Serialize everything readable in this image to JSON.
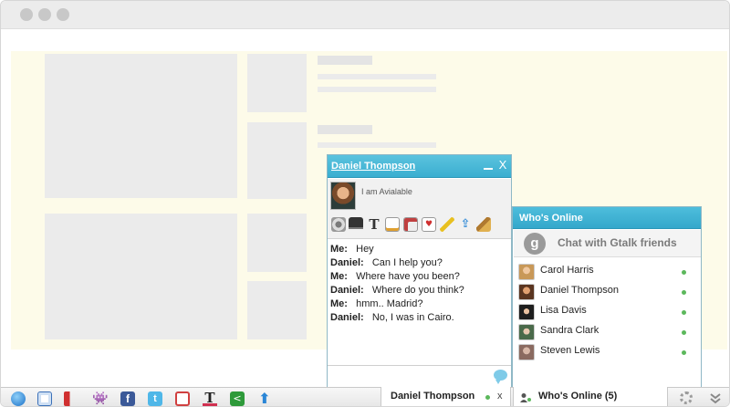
{
  "chat": {
    "contact_name": "Daniel Thompson",
    "status": "I am Avialable",
    "minimize_icon": "minimize-icon",
    "close_glyph": "X",
    "toolbar_icons": [
      "webcam-icon",
      "monitor-icon",
      "text-format-icon",
      "notepad-icon",
      "documents-icon",
      "playing-card-icon",
      "pencil-icon",
      "upload-icon",
      "broom-icon"
    ],
    "messages": [
      {
        "sender": "Me:",
        "text": "Hey"
      },
      {
        "sender": "Daniel:",
        "text": "Can I help you?"
      },
      {
        "sender": "Me:",
        "text": "Where have you been?"
      },
      {
        "sender": "Daniel:",
        "text": "Where do you think?"
      },
      {
        "sender": "Me:",
        "text": "hmm.. Madrid?"
      },
      {
        "sender": "Daniel:",
        "text": "No, I was in Cairo."
      }
    ],
    "send_icon": "speech-bubble-icon"
  },
  "who_online": {
    "title": "Who's Online",
    "gtalk_label": "Chat with Gtalk friends",
    "gtalk_icon_glyph": "g",
    "friends": [
      {
        "name": "Carol Harris",
        "status": "online"
      },
      {
        "name": "Daniel Thompson",
        "status": "online"
      },
      {
        "name": "Lisa Davis",
        "status": "online"
      },
      {
        "name": "Sandra Clark",
        "status": "online"
      },
      {
        "name": "Steven Lewis",
        "status": "online"
      }
    ]
  },
  "bottom_bar": {
    "icons": [
      "globe-icon",
      "contacts-icon",
      "announcement-icon",
      "space-invader-icon",
      "facebook-icon",
      "twitter-icon",
      "photo-icon",
      "text-icon",
      "share-icon",
      "upload-arrow-icon"
    ],
    "chat_tab_label": "Daniel Thompson",
    "chat_tab_close": "x",
    "who_tab_label": "Who's Online (5)",
    "settings_icon": "gear-icon",
    "collapse_icon": "double-chevron-down-icon"
  },
  "colors": {
    "header_blue": "#3aaed0",
    "online_green": "#5cb85c",
    "page_bg": "#fdfbe9"
  }
}
